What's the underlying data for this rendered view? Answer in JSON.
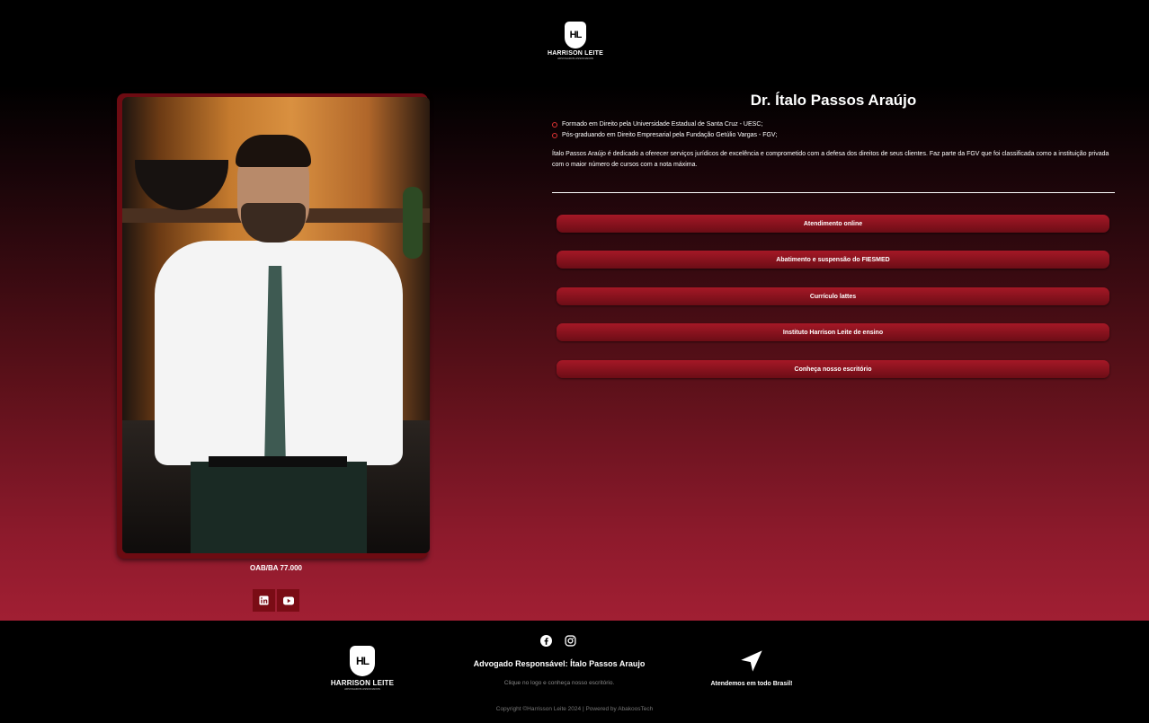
{
  "header": {
    "logo_text": "HARRISON LEITE",
    "logo_sub": "ADVOGADOS ASSOCIADOS",
    "logo_monogram": "HL"
  },
  "profile": {
    "name": "Dr. Ítalo Passos Araújo",
    "credentials": [
      "Formado em Direito pela Universidade Estadual de Santa Cruz - UESC;",
      "Pós-graduando em Direito Empresarial pela Fundação Getúlio Vargas - FGV;"
    ],
    "bio": "Ítalo Passos Araújo é dedicado a oferecer serviços jurídicos de excelência e comprometido com a defesa dos direitos de seus clientes. Faz parte da FGV que foi classificada como a instituição privada com o maior número de cursos com a nota máxima.",
    "oab": "OAB/BA 77.000"
  },
  "links": [
    "Atendimento online",
    "Abatimento e suspensão do FIESMED",
    "Currículo lattes",
    "Instituto Harrison Leite de ensino",
    "Conheça nosso escritório"
  ],
  "social_left": [
    "linkedin-icon",
    "youtube-icon"
  ],
  "footer": {
    "logo_text": "HARRISON LEITE",
    "logo_sub": "ADVOGADOS ASSOCIADOS",
    "social": [
      "facebook-icon",
      "instagram-icon"
    ],
    "title": "Advogado Responsável: Ítalo Passos Araujo",
    "subtitle": "Clique no logo e conheça nosso escritório.",
    "nav_text": "Atendemos em todo Brasil!",
    "copyright": "Copyright ©Harrisson Leite 2024 | Powered by AbakoosTech"
  },
  "colors": {
    "accent": "#a51826",
    "dark_red": "#6d0b12",
    "bg": "#000000"
  }
}
